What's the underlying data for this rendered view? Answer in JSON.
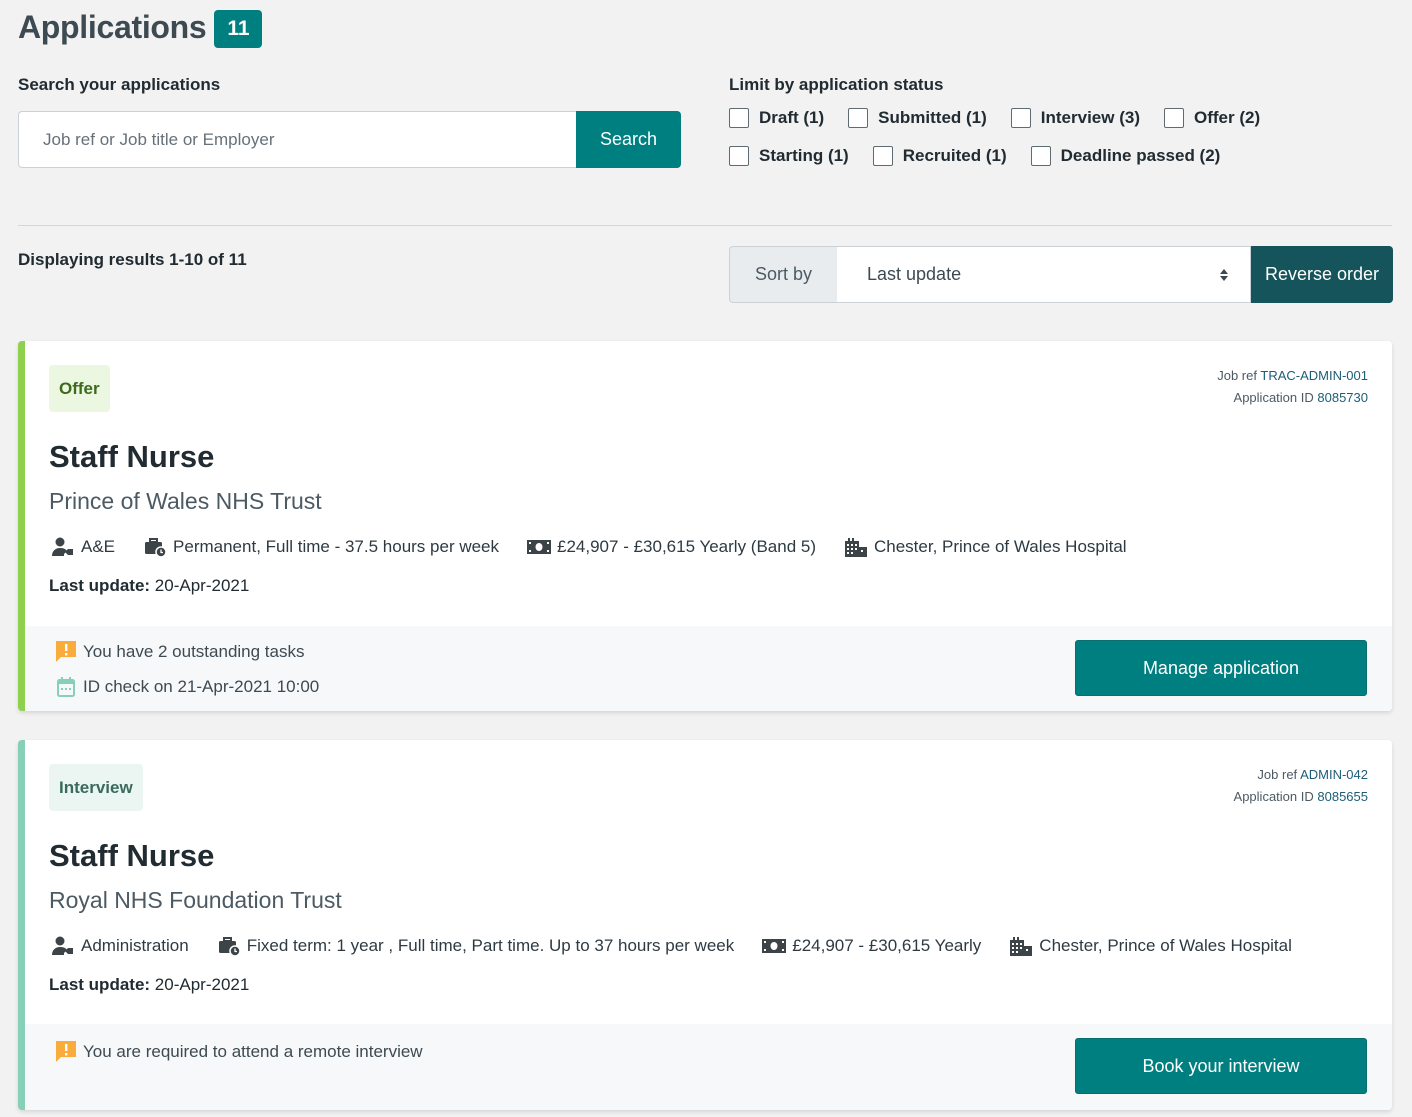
{
  "header": {
    "title": "Applications",
    "count": "11"
  },
  "search": {
    "label": "Search your applications",
    "placeholder": "Job ref or Job title or Employer",
    "value": "",
    "button_label": "Search"
  },
  "status_filter": {
    "label": "Limit by application status",
    "options": [
      {
        "label": "Draft (1)",
        "checked": false
      },
      {
        "label": "Submitted (1)",
        "checked": false
      },
      {
        "label": "Interview (3)",
        "checked": false
      },
      {
        "label": "Offer (2)",
        "checked": false
      },
      {
        "label": "Starting (1)",
        "checked": false
      },
      {
        "label": "Recruited (1)",
        "checked": false
      },
      {
        "label": "Deadline passed (2)",
        "checked": false
      }
    ]
  },
  "results": {
    "summary": "Displaying results 1-10 of 11"
  },
  "sort": {
    "label": "Sort by",
    "selected": "Last update",
    "reverse_label": "Reverse order"
  },
  "colors": {
    "accent": "#007f80",
    "reverse_button": "#14545a",
    "offer_stripe": "#8fd14f",
    "interview_stripe": "#86d0b8",
    "warning": "#f9ab3b",
    "calendar": "#86d0b8"
  },
  "applications": [
    {
      "status": "Offer",
      "job_ref_label": "Job ref",
      "job_ref": "TRAC-ADMIN-001",
      "app_id_label": "Application ID",
      "app_id": "8085730",
      "title": "Staff Nurse",
      "employer": "Prince of Wales NHS Trust",
      "department": "A&E",
      "contract": "Permanent, Full time - 37.5 hours per week",
      "salary": "£24,907 - £30,615 Yearly (Band 5)",
      "location": "Chester, Prince of Wales Hospital",
      "last_update_label": "Last update:",
      "last_update": "20-Apr-2021",
      "notes": [
        {
          "icon": "warning-icon",
          "text": "You have 2 outstanding tasks"
        },
        {
          "icon": "calendar-icon",
          "text": "ID check on 21-Apr-2021 10:00"
        }
      ],
      "action_label": "Manage application"
    },
    {
      "status": "Interview",
      "job_ref_label": "Job ref",
      "job_ref": "ADMIN-042",
      "app_id_label": "Application ID",
      "app_id": "8085655",
      "title": "Staff Nurse",
      "employer": "Royal NHS Foundation Trust",
      "department": "Administration",
      "contract": "Fixed term: 1 year , Full time, Part time. Up to 37 hours per week",
      "salary": "£24,907 - £30,615 Yearly",
      "location": "Chester, Prince of Wales Hospital",
      "last_update_label": "Last update:",
      "last_update": "20-Apr-2021",
      "notes": [
        {
          "icon": "warning-icon",
          "text": "You are required to attend a remote interview"
        }
      ],
      "action_label": "Book your interview"
    }
  ]
}
